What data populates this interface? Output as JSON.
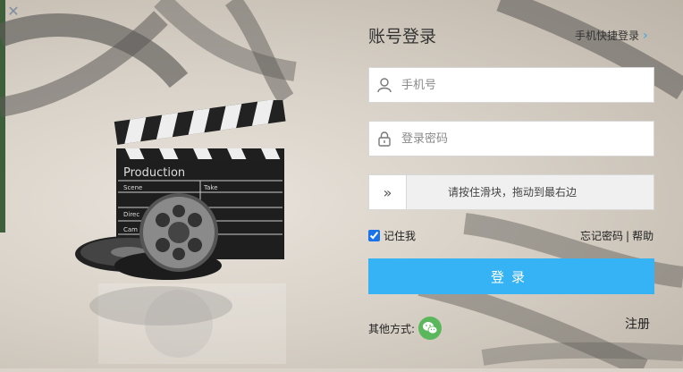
{
  "window": {
    "close_icon": "close-icon"
  },
  "panel": {
    "title": "账号登录",
    "quick_login_label": "手机快捷登录",
    "quick_login_icon": "chevron-right-icon"
  },
  "form": {
    "phone": {
      "placeholder": "手机号",
      "value": "",
      "icon": "user-icon"
    },
    "password": {
      "placeholder": "登录密码",
      "value": "",
      "icon": "lock-icon"
    },
    "slider": {
      "handle_icon": "double-chevron-right-icon",
      "text": "请按住滑块，拖动到最右边"
    },
    "remember": {
      "label": "记住我",
      "checked": true
    },
    "forgot_label": "忘记密码",
    "separator": "|",
    "help_label": "帮助",
    "login_label": "登录"
  },
  "footer": {
    "other_label": "其他方式:",
    "wechat_icon": "wechat-icon",
    "register_label": "注册"
  },
  "illustration": {
    "clapper_title": "Production",
    "clapper_scene": "Scene",
    "clapper_take": "Take",
    "clapper_director": "Direc",
    "clapper_camera": "Cam"
  },
  "colors": {
    "accent": "#36b3f5",
    "link_chevron": "#3aa6e6",
    "wechat": "#5bb75b"
  }
}
